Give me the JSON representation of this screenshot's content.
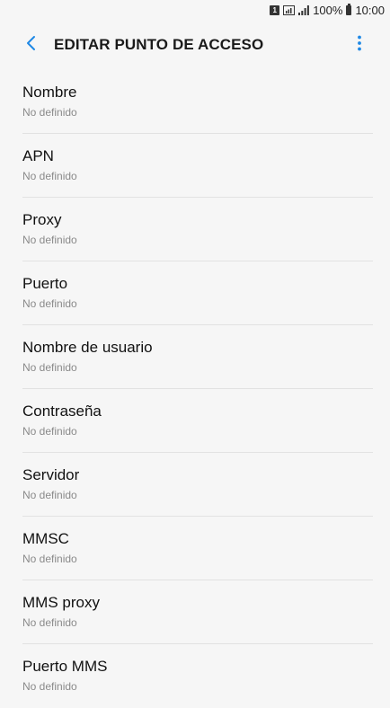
{
  "status_bar": {
    "sim": "1",
    "battery_text": "100%",
    "time": "10:00"
  },
  "app_bar": {
    "title": "EDITAR PUNTO DE ACCESO",
    "back_icon": "chevron-left-icon",
    "more_icon": "more-vert-icon",
    "accent_color": "#1e88e5"
  },
  "settings": [
    {
      "label": "Nombre",
      "value": "No definido"
    },
    {
      "label": "APN",
      "value": "No definido"
    },
    {
      "label": "Proxy",
      "value": "No definido"
    },
    {
      "label": "Puerto",
      "value": "No definido"
    },
    {
      "label": "Nombre de usuario",
      "value": "No definido"
    },
    {
      "label": "Contraseña",
      "value": "No definido"
    },
    {
      "label": "Servidor",
      "value": "No definido"
    },
    {
      "label": "MMSC",
      "value": "No definido"
    },
    {
      "label": "MMS proxy",
      "value": "No definido"
    },
    {
      "label": "Puerto MMS",
      "value": "No definido"
    }
  ]
}
